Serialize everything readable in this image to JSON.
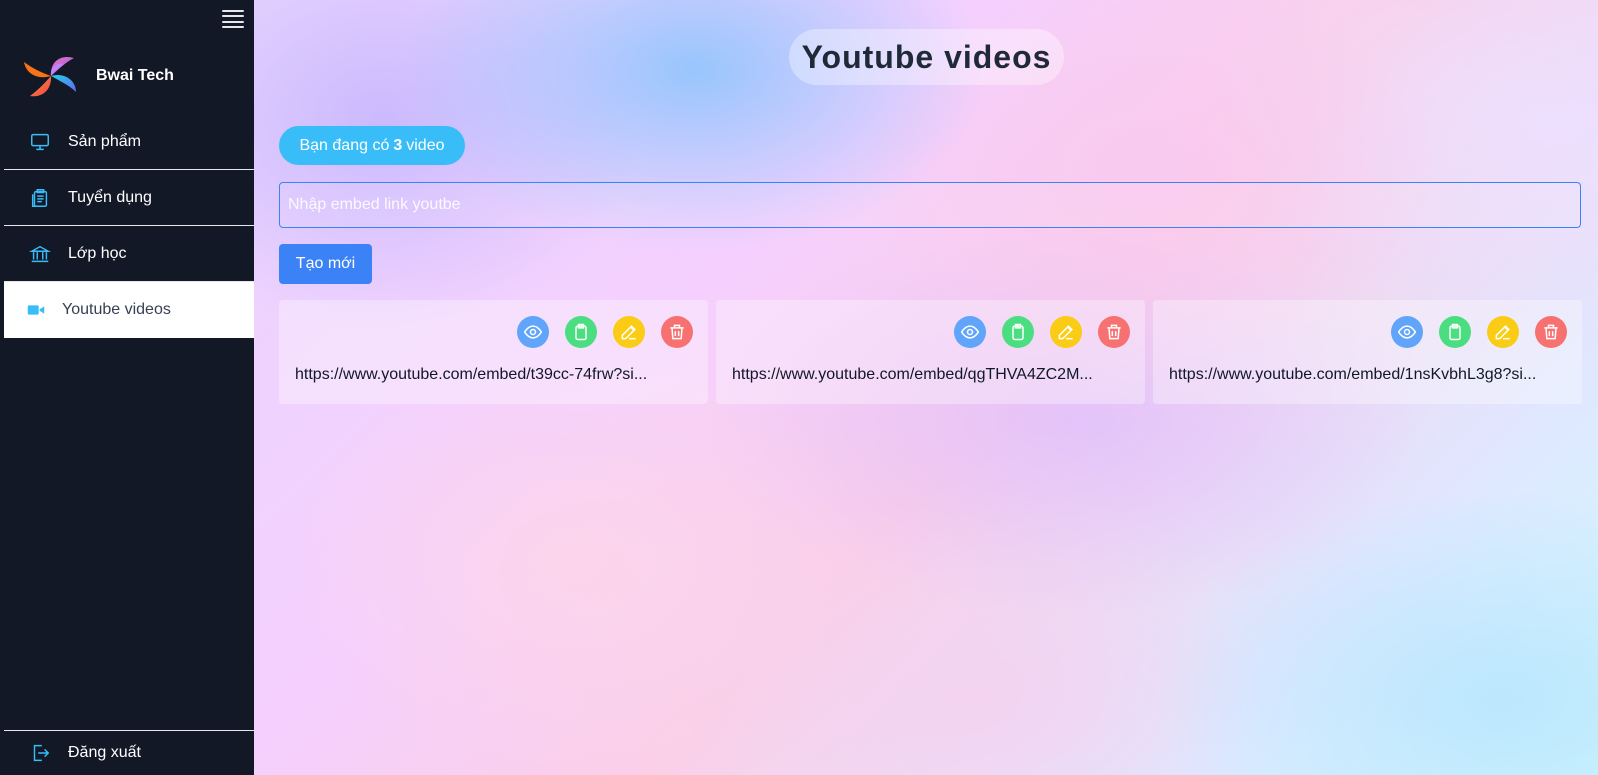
{
  "sidebar": {
    "brand": {
      "name": "Bwai Tech"
    },
    "items": [
      {
        "label": "Sản phẩm",
        "icon": "monitor-icon"
      },
      {
        "label": "Tuyển dụng",
        "icon": "clipboard-list-icon"
      },
      {
        "label": "Lớp học",
        "icon": "building-columns-icon"
      },
      {
        "label": "Youtube videos",
        "icon": "video-camera-icon",
        "active": true
      }
    ],
    "logout": {
      "label": "Đăng xuất",
      "icon": "logout-icon"
    }
  },
  "main": {
    "title": "Youtube videos",
    "count": {
      "prefix": "Bạn đang có",
      "value": "3",
      "suffix": "video"
    },
    "input": {
      "placeholder": "Nhập embed link youtbe",
      "value": ""
    },
    "create_label": "Tạo mới",
    "videos": [
      {
        "url": "https://www.youtube.com/embed/t39cc-74frw?si..."
      },
      {
        "url": "https://www.youtube.com/embed/qgTHVA4ZC2M..."
      },
      {
        "url": "https://www.youtube.com/embed/1nsKvbhL3g8?si..."
      }
    ],
    "actions": [
      "eye-icon",
      "clipboard-icon",
      "edit-icon",
      "trash-icon"
    ]
  },
  "colors": {
    "sidebar_bg": "#121826",
    "accent_blue": "#3b82f6",
    "pill_blue": "#38bdf8",
    "view": "#60a5fa",
    "copy": "#4ade80",
    "edit": "#facc15",
    "delete": "#f87171"
  }
}
